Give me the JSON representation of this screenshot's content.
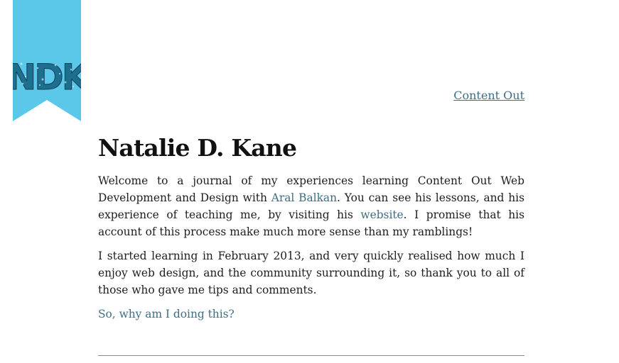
{
  "logo": {
    "text": "NDK",
    "ribbon_color": "#5bc8ea",
    "letter_color": "#1d6e8f"
  },
  "nav": {
    "content_out_label": "Content Out"
  },
  "main": {
    "title": "Natalie D. Kane",
    "intro": {
      "part1": "Welcome to a journal of my experiences learning Content Out Web Development and Design with ",
      "link1": "Aral Balkan",
      "part2": ". You can see his lessons, and his experience of teaching me, by visiting his ",
      "link2": "website",
      "part3": ". I promise that his account of this process make much more sense than my ramblings!"
    },
    "second_paragraph": "I started learning in February 2013, and very quickly realised how much I enjoy web design, and the community surrounding it, so thank you to all of those who gave me tips and comments.",
    "question_link": "So, why am I doing this?"
  },
  "colors": {
    "link": "#3f6e86",
    "text": "#1e1e1e",
    "rule": "#8a8a8a"
  }
}
